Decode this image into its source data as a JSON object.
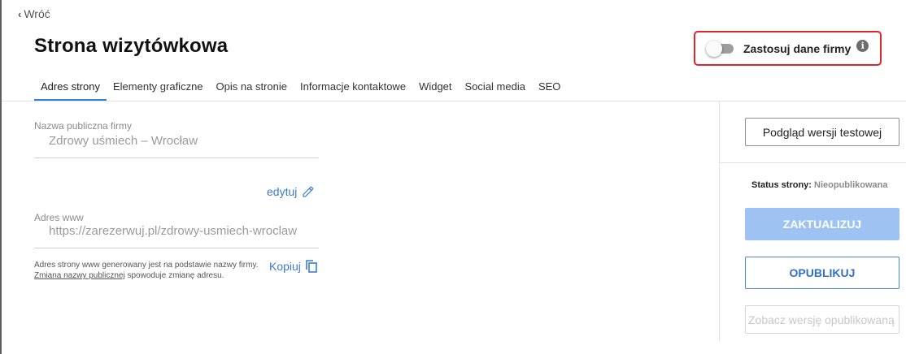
{
  "back": {
    "label": "Wróć"
  },
  "page": {
    "title": "Strona wizytówkowa"
  },
  "toggle": {
    "label": "Zastosuj dane firmy",
    "state": "off",
    "highlight_color": "#e0262d"
  },
  "tabs": [
    {
      "label": "Adres strony",
      "active": true
    },
    {
      "label": "Elementy graficzne",
      "active": false
    },
    {
      "label": "Opis na stronie",
      "active": false
    },
    {
      "label": "Informacje kontaktowe",
      "active": false
    },
    {
      "label": "Widget",
      "active": false
    },
    {
      "label": "Social media",
      "active": false
    },
    {
      "label": "SEO",
      "active": false
    }
  ],
  "form": {
    "public_name": {
      "label": "Nazwa publiczna firmy",
      "value": "Zdrowy uśmiech – Wrocław"
    },
    "edit_label": "edytuj",
    "www": {
      "label": "Adres www",
      "value": "https://zarezerwuj.pl/zdrowy-usmiech-wroclaw"
    },
    "help_line1": "Adres strony www generowany jest na podstawie nazwy firmy.",
    "help_link": "Zmiana nazwy publicznej",
    "help_line2_rest": " spowoduje zmianę adresu.",
    "copy_label": "Kopiuj"
  },
  "sidebar": {
    "preview_button": "Podgląd wersji testowej",
    "status_label": "Status strony:",
    "status_value": "Nieopublikowana",
    "update_button": "ZAKTUALIZUJ",
    "publish_button": "OPUBLIKUJ",
    "view_published_button": "Zobacz wersję opublikowaną"
  },
  "colors": {
    "accent": "#3a7bd5",
    "tab_underline": "#2f7fd6",
    "update_disabled": "#9ec3f2"
  }
}
